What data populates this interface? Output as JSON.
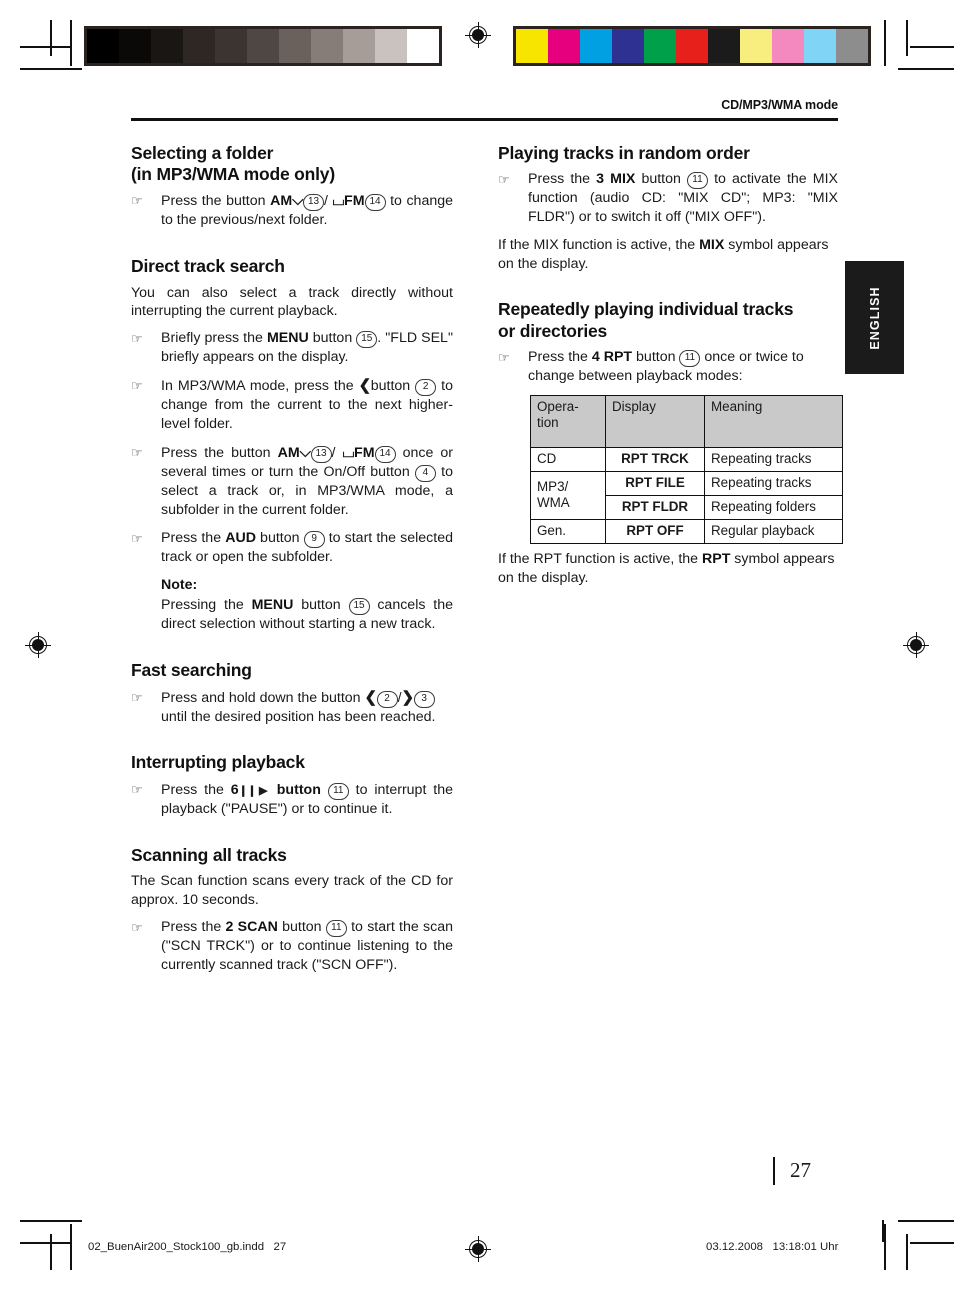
{
  "page": {
    "running_head": "CD/MP3/WMA mode",
    "side_tab": "ENGLISH",
    "folio": "27"
  },
  "footer": {
    "file": "02_BuenAir200_Stock100_gb.indd   27",
    "stamp": "03.12.2008   13:18:01 Uhr"
  },
  "calibration": {
    "grayscale": [
      "#000000",
      "#0b0908",
      "#1a1614",
      "#2e2724",
      "#3c3430",
      "#4f4744",
      "#6a615d",
      "#867c78",
      "#a69d99",
      "#c9c2be",
      "#ffffff"
    ],
    "colors": [
      "#f7e500",
      "#e6007e",
      "#00a0e3",
      "#2e3191",
      "#00a04a",
      "#e8201c",
      "#1b1b1b",
      "#f8ee80",
      "#f489c0",
      "#80d4f5",
      "#8d8d8d"
    ]
  },
  "left_column": {
    "s1": {
      "title_line1": "Selecting a folder",
      "title_line2": "(in MP3/WMA mode only)",
      "bullet": {
        "pre": "Press  the  button  ",
        "am": "AM",
        "ref_am": "13",
        "sep": "/ ",
        "fm": "FM",
        "ref_fm": "14",
        "post": "  to change to the previous/next folder."
      }
    },
    "s2": {
      "title": "Direct track search",
      "intro": "You can also select a track directly without interrupting the current playback.",
      "b1": {
        "pre": "Briefly  press  the  ",
        "bold": "MENU",
        "mid": " button  ",
        "ref": "15",
        "post": ". \"FLD SEL\" briefly appears on the display."
      },
      "b2": {
        "pre": "In MP3/WMA mode, press the ",
        "mid": "button ",
        "ref": "2",
        "post": " to change from the current to the next higher-level folder."
      },
      "b3": {
        "pre": "Press the button ",
        "am": "AM",
        "ref_am": "13",
        "sep": "/ ",
        "fm": "FM",
        "ref_fm": "14",
        "mid": " once or several times or turn the On/Off button ",
        "ref_onoff": "4",
        "post": " to select  a  track  or,  in  MP3/WMA  mode,  a subfolder in the current folder."
      },
      "b4": {
        "pre": "Press the ",
        "bold": "AUD",
        "mid": " button ",
        "ref": "9",
        "post": " to start the selected track or open the subfolder."
      },
      "note_label": "Note:",
      "note": {
        "pre": "Pressing the ",
        "bold": "MENU",
        "mid": " button ",
        "ref": "15",
        "post": " cancels the direct  selection  without  starting  a  new track."
      }
    },
    "s3": {
      "title": "Fast searching",
      "bullet": {
        "pre": "Press and hold down the button ",
        "ref_left": "2",
        "sep": "/",
        "ref_right": "3",
        "post": " until the desired position has been reached."
      }
    },
    "s4": {
      "title": "Interrupting playback",
      "bullet": {
        "pre": "Press  the  ",
        "num": "6",
        "bold": "button",
        "ref": "11",
        "post": "  to  interrupt  the playback (\"PAUSE\") or to continue it."
      }
    },
    "s5": {
      "title": "Scanning all tracks",
      "intro": "The Scan function scans every track of the CD for approx. 10 seconds.",
      "bullet": {
        "pre": "Press the ",
        "bold": "2 SCAN",
        "mid": " button ",
        "ref": "11",
        "post": " to start the scan (\"SCN TRCK\") or to continue listening to the currently scanned track (\"SCN OFF\")."
      }
    }
  },
  "right_column": {
    "s1": {
      "title": "Playing tracks in random order",
      "bullet": {
        "pre": "Press  the  ",
        "bold": "3 MIX",
        "mid": " button ",
        "ref": "11",
        "post": "  to  activate  the MIX function (audio CD: \"MIX CD\"; MP3: \"MIX FLDR\") or to switch it off (\"MIX OFF\")."
      },
      "note": {
        "pre": "If the MIX function is active, the ",
        "bold": "MIX",
        "post": " symbol appears on the display."
      }
    },
    "s2": {
      "title_line1": "Repeatedly playing individual tracks",
      "title_line2": "or directories",
      "bullet": {
        "pre": "Press the ",
        "bold": "4 RPT",
        "mid": " button ",
        "ref": "11",
        "post": " once or twice to change between playback modes:"
      },
      "table": {
        "headers": [
          "Opera-tion",
          "Display",
          "Meaning"
        ],
        "header_operation_line1": "Opera-",
        "header_operation_line2": "tion",
        "rows": [
          {
            "operation": "CD",
            "operation_rowspan": 1,
            "display": "RPT TRCK",
            "meaning": "Repeating tracks"
          },
          {
            "operation": "MP3/ WMA",
            "operation_rowspan": 2,
            "display": "RPT FILE",
            "meaning": "Repeating tracks"
          },
          {
            "operation": "",
            "operation_rowspan": 0,
            "display": "RPT FLDR",
            "meaning": "Repeating folders"
          },
          {
            "operation": "Gen.",
            "operation_rowspan": 1,
            "display": "RPT OFF",
            "meaning": "Regular playback"
          }
        ],
        "mp3_line1": "MP3/",
        "mp3_line2": "WMA"
      },
      "note": {
        "pre": "If the RPT function is active, the ",
        "bold": "RPT",
        "post": " symbol appears on the display."
      }
    }
  }
}
